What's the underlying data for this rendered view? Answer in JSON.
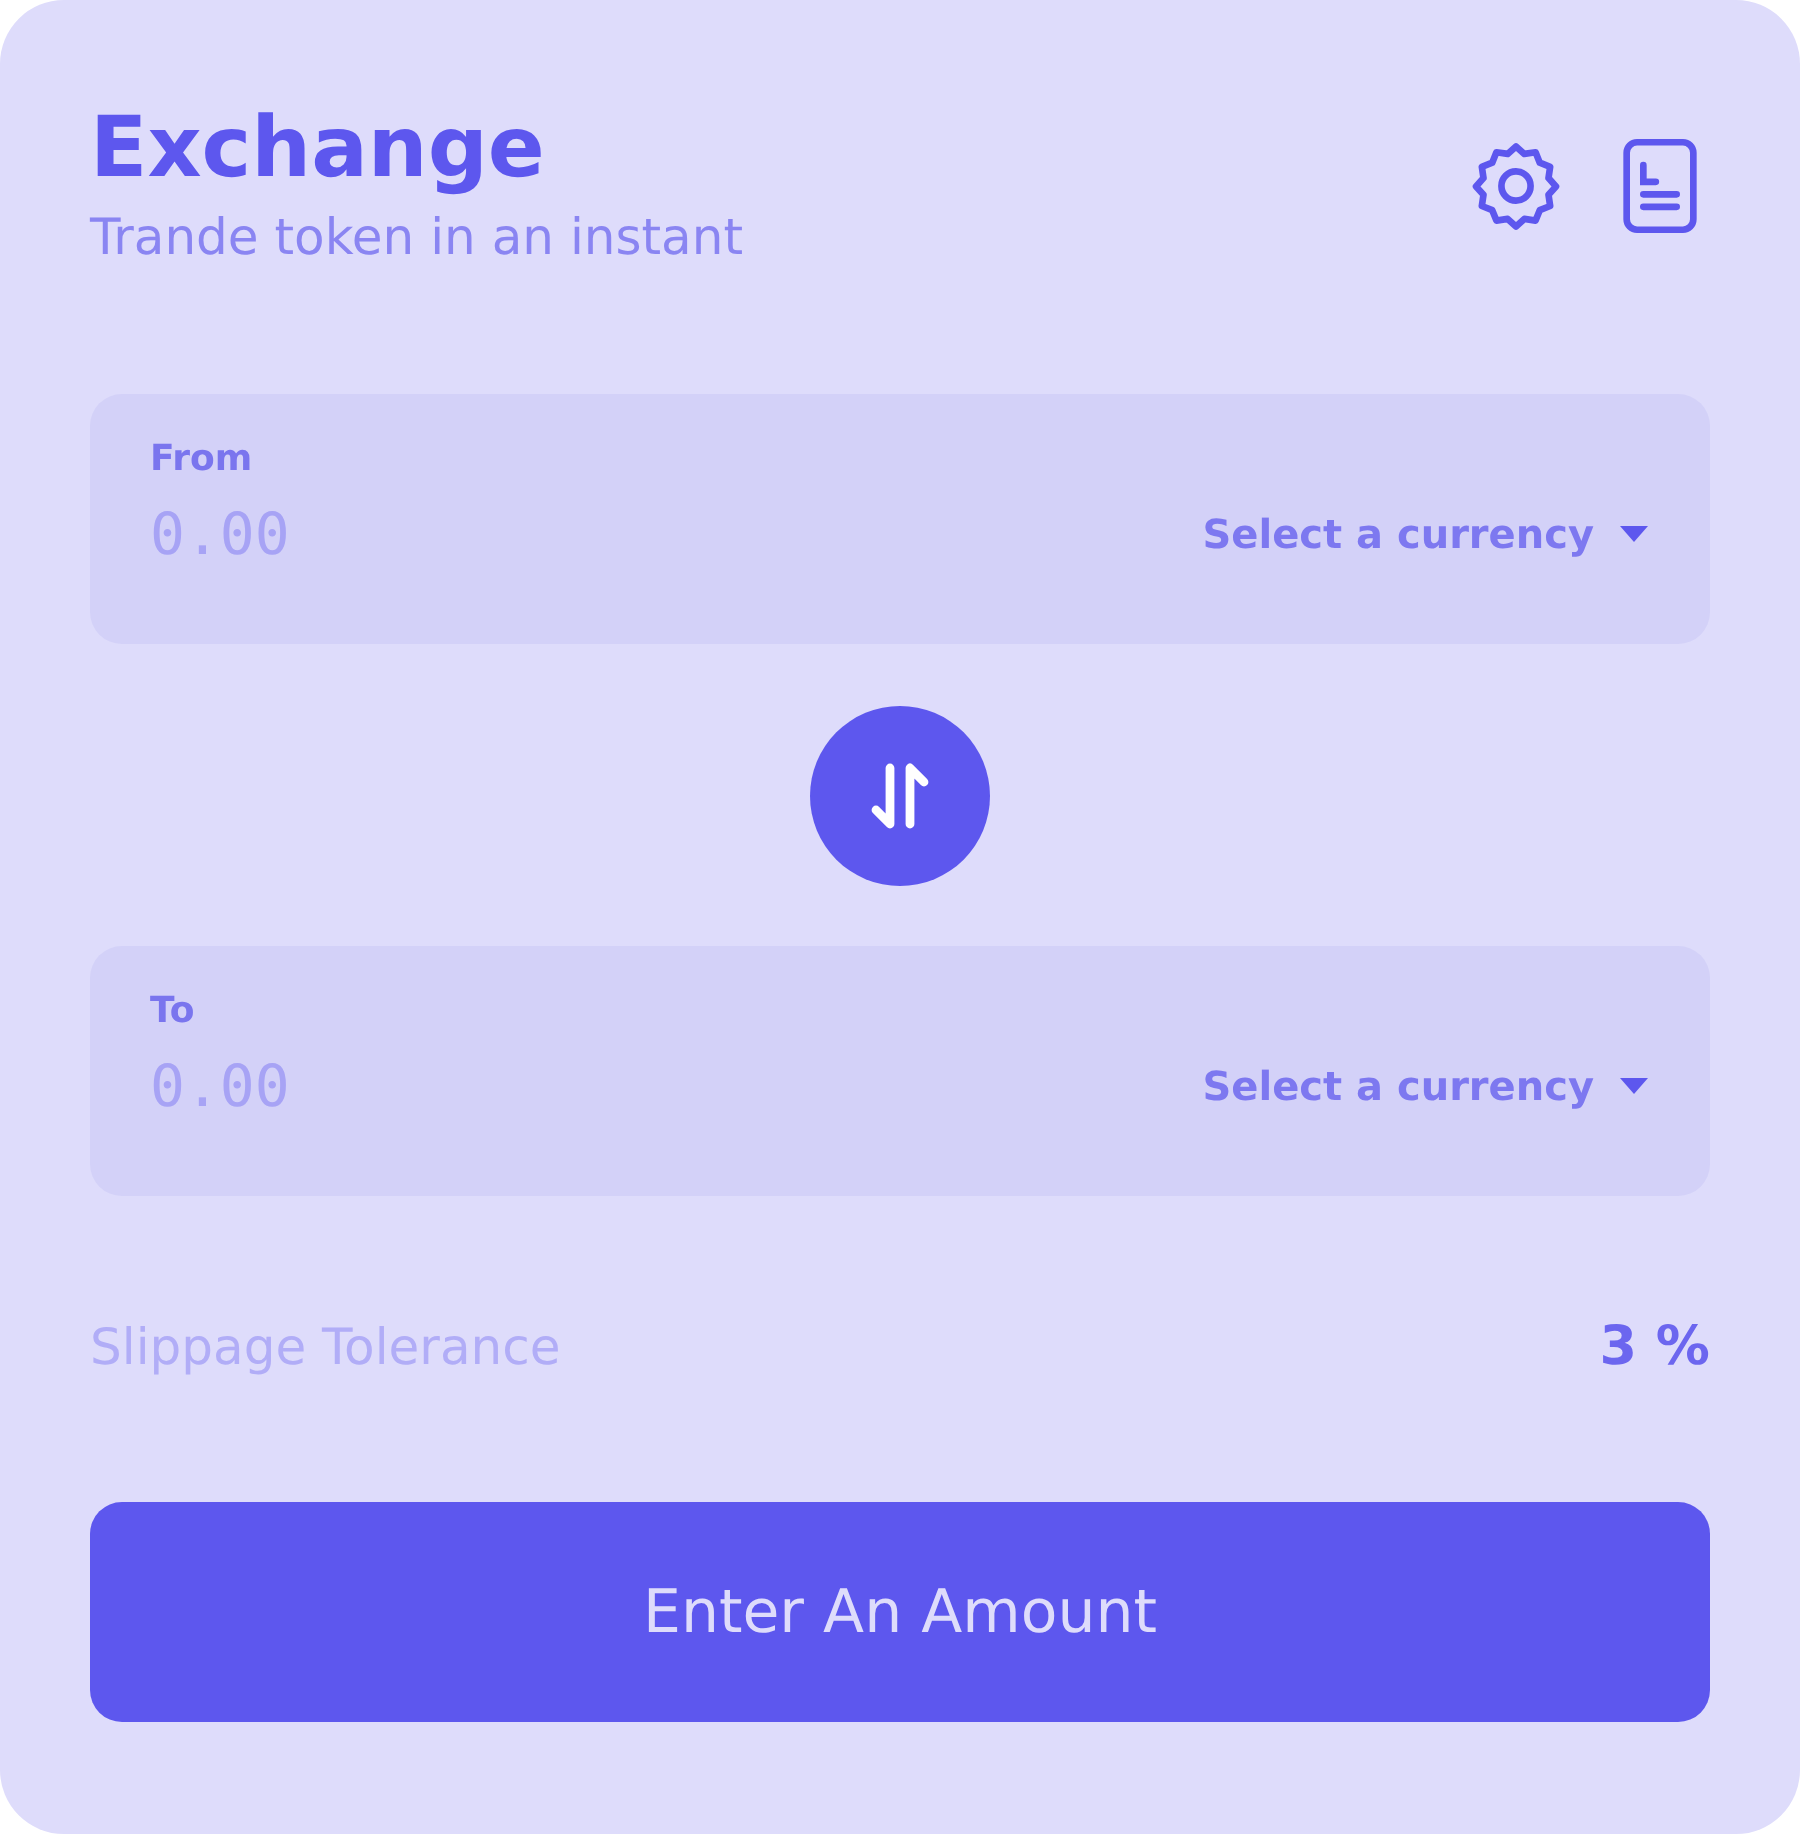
{
  "header": {
    "title": "Exchange",
    "subtitle": "Trande token in an instant"
  },
  "panels": [
    {
      "label": "From",
      "placeholder": "0.00",
      "currency_button": "Select a currency"
    },
    {
      "label": "To",
      "placeholder": "0.00",
      "currency_button": "Select a currency"
    }
  ],
  "slippage": {
    "label": "Slippage Tolerance",
    "value": "3 %"
  },
  "submit_button": "Enter An Amount"
}
